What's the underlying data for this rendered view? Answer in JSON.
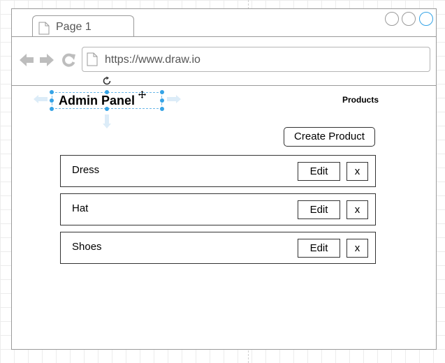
{
  "browser": {
    "tab_label": "Page 1",
    "url": "https://www.draw.io"
  },
  "header": {
    "title": "Admin Panel",
    "products_label": "Products"
  },
  "main": {
    "create_label": "Create Product",
    "products": [
      {
        "name": "Dress",
        "edit_label": "Edit",
        "delete_label": "x"
      },
      {
        "name": "Hat",
        "edit_label": "Edit",
        "delete_label": "x"
      },
      {
        "name": "Shoes",
        "edit_label": "Edit",
        "delete_label": "x"
      }
    ]
  },
  "colors": {
    "selection": "#35a3e6",
    "border": "#333333",
    "window_border": "#9a9a9a"
  }
}
